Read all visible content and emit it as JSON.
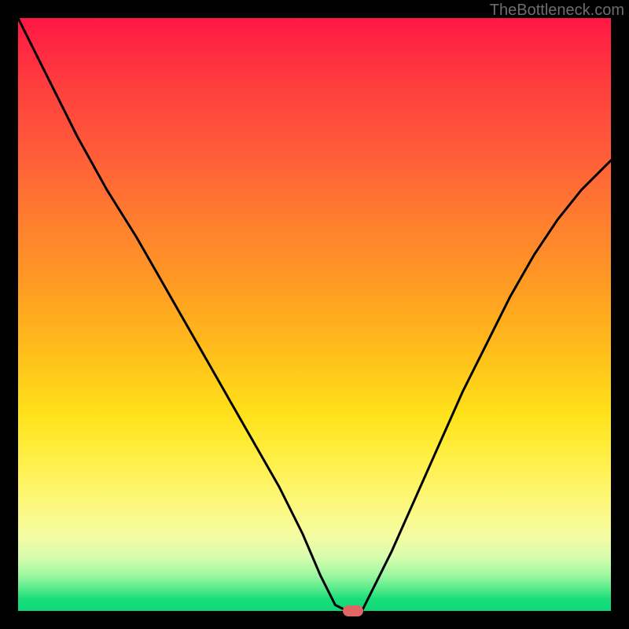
{
  "watermark": "TheBottleneck.com",
  "chart_data": {
    "type": "line",
    "title": "",
    "xlabel": "",
    "ylabel": "",
    "xlim": [
      0,
      100
    ],
    "ylim": [
      0,
      100
    ],
    "grid": false,
    "legend": false,
    "background_gradient": {
      "orientation": "vertical",
      "stops": [
        {
          "pos": 0,
          "color": "#ff1744"
        },
        {
          "pos": 50,
          "color": "#ffb020"
        },
        {
          "pos": 75,
          "color": "#fff04a"
        },
        {
          "pos": 100,
          "color": "#10d877"
        }
      ]
    },
    "series": [
      {
        "name": "bottleneck-curve",
        "color": "#000000",
        "x": [
          0,
          5,
          10,
          15,
          20,
          24,
          28,
          32,
          36,
          40,
          44,
          48,
          51,
          53.5,
          55.5,
          58,
          59,
          63,
          67,
          71,
          75,
          79,
          83,
          87,
          91,
          95,
          100
        ],
        "values": [
          100,
          90,
          80,
          71,
          63,
          56,
          49,
          42,
          35,
          28,
          21,
          13,
          6,
          1,
          0,
          0,
          2,
          10,
          19,
          28,
          37,
          45,
          53,
          60,
          66,
          71,
          76
        ]
      }
    ],
    "marker": {
      "x": 56.5,
      "y": 0,
      "color": "#e06666"
    }
  }
}
